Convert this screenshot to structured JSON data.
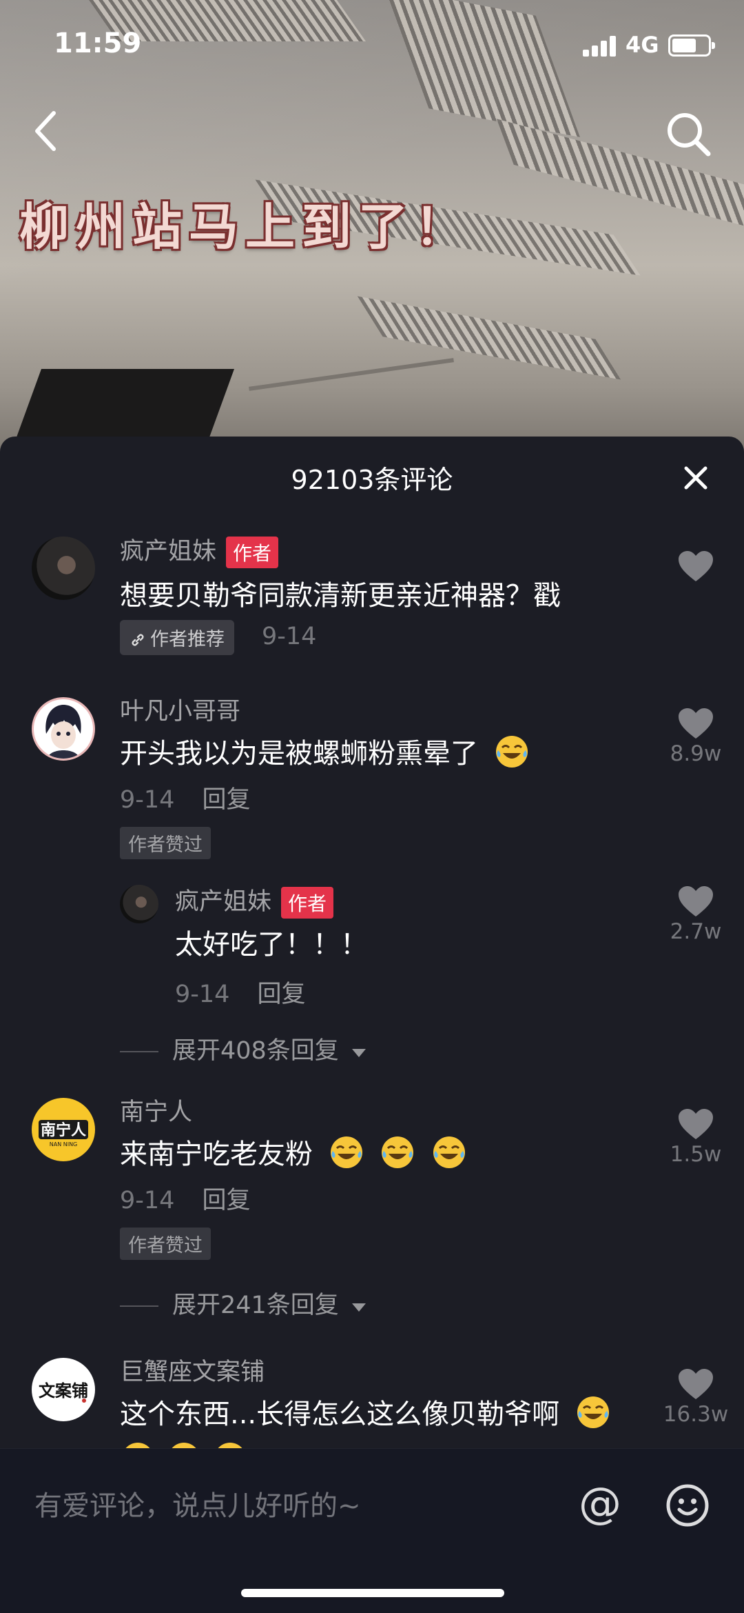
{
  "status_bar": {
    "time": "11:59",
    "network": "4G"
  },
  "video": {
    "caption": "柳州站马上到了！"
  },
  "panel": {
    "title": "92103条评论",
    "comments": [
      {
        "author": "疯产姐妹",
        "author_tag": "作者",
        "text": "想要贝勒爷同款清新更亲近神器？戳",
        "recommend_badge": "作者推荐",
        "date": "9-14"
      },
      {
        "author": "叶凡小哥哥",
        "text": "开头我以为是被螺蛳粉熏晕了",
        "date": "9-14",
        "reply_label": "回复",
        "liked_badge": "作者赞过",
        "likes": "8.9w",
        "sub_reply": {
          "author": "疯产姐妹",
          "author_tag": "作者",
          "text": "太好吃了！！！",
          "date": "9-14",
          "reply_label": "回复",
          "likes": "2.7w"
        },
        "expand_label": "展开408条回复"
      },
      {
        "author": "南宁人",
        "text": "来南宁吃老友粉",
        "date": "9-14",
        "reply_label": "回复",
        "liked_badge": "作者赞过",
        "likes": "1.5w",
        "expand_label": "展开241条回复"
      },
      {
        "author": "巨蟹座文案铺",
        "text": "这个东西...长得怎么这么像贝勒爷啊",
        "likes": "16.3w"
      }
    ]
  },
  "input": {
    "placeholder": "有爱评论，说点儿好听的~"
  },
  "colors": {
    "panel_bg": "#1c1d25",
    "author_tag": "#e4334a"
  },
  "icons": [
    "back-arrow-icon",
    "search-icon",
    "close-icon",
    "heart-icon",
    "link-icon",
    "tears-of-joy-emoji-icon",
    "at-icon",
    "smiley-icon"
  ]
}
